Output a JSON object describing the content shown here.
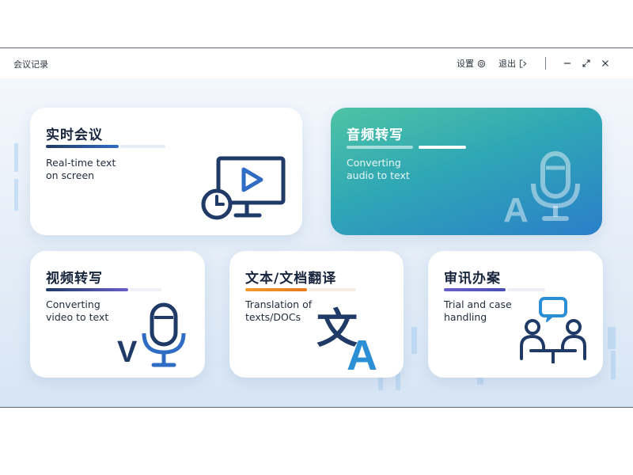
{
  "window": {
    "title": "会议记录",
    "settings_label": "设置",
    "logout_label": "退出"
  },
  "colors": {
    "navy": "#1f3a66",
    "blue": "#2f6dc4",
    "audio_gradient_start": "#4ec3a4",
    "audio_gradient_end": "#2a7fc9",
    "orange": "#f29a2e",
    "purple": "#6a5fc8",
    "light_blue": "#2b8fd6"
  },
  "cards": {
    "realtime": {
      "title": "实时会议",
      "subtitle_line1": "Real-time text",
      "subtitle_line2": "on screen",
      "icon": "monitor-play-clock-icon"
    },
    "audio": {
      "title": "音频转写",
      "subtitle_line1": "Converting",
      "subtitle_line2": "audio to text",
      "icon": "microphone-a-icon"
    },
    "video": {
      "title": "视频转写",
      "subtitle_line1": "Converting",
      "subtitle_line2": "video to text",
      "icon": "microphone-v-icon",
      "glyph": "V"
    },
    "translate": {
      "title": "文本/文档翻译",
      "subtitle_line1": "Translation of",
      "subtitle_line2": "texts/DOCs",
      "icon": "translate-icon",
      "glyph1": "文",
      "glyph2": "A"
    },
    "trial": {
      "title": "审讯办案",
      "subtitle_line1": "Trial and case",
      "subtitle_line2": "handling",
      "icon": "interrogation-icon"
    }
  },
  "audio_glyph": "A"
}
